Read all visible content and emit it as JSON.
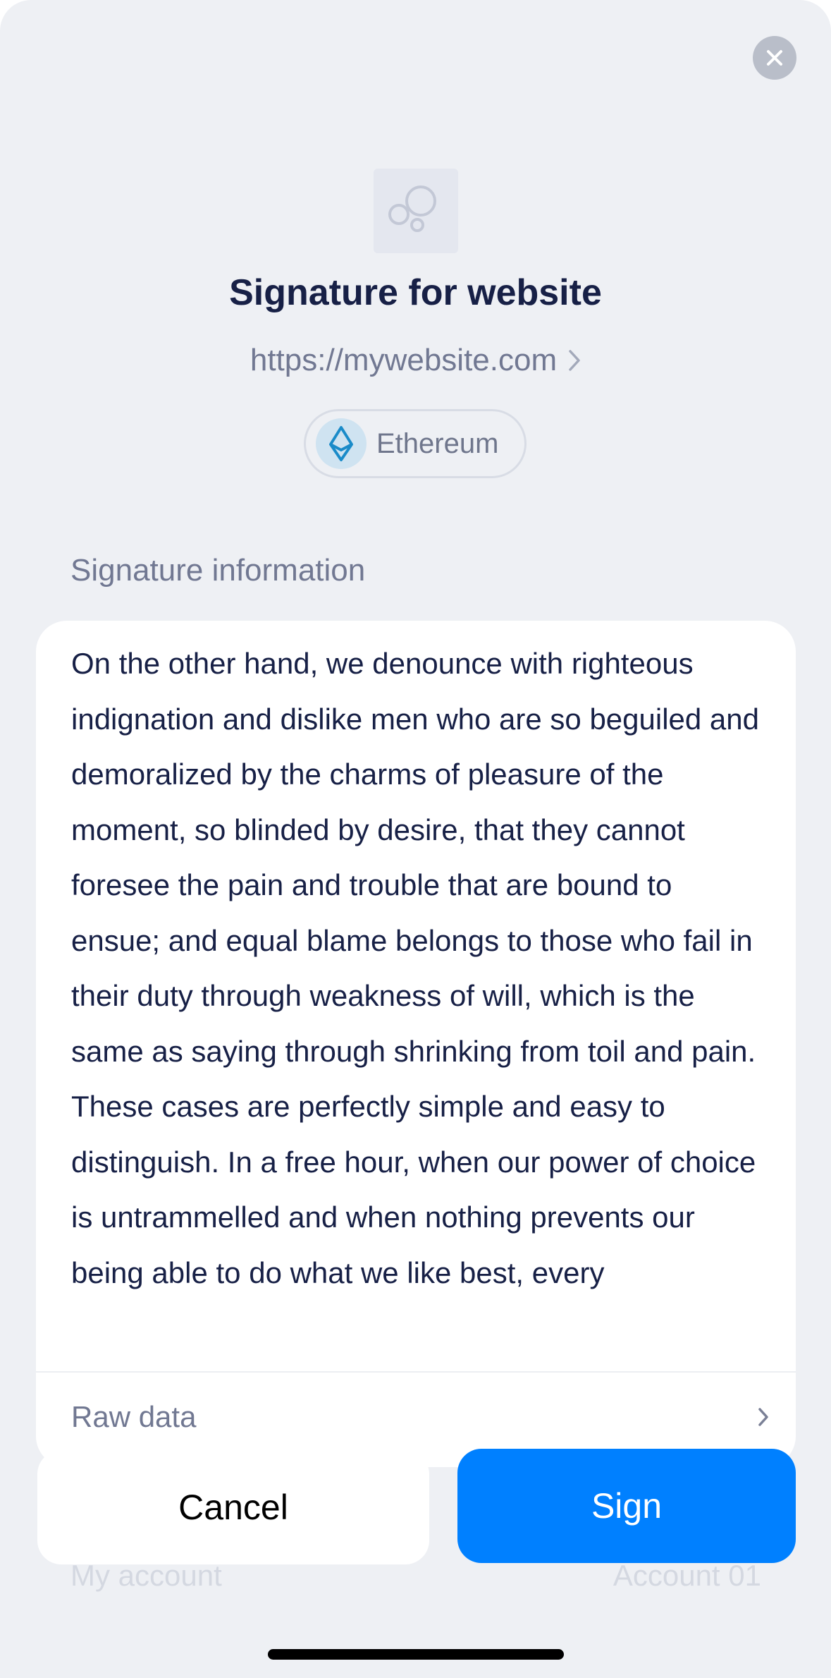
{
  "header": {
    "title": "Signature for website",
    "url": "https://mywebsite.com",
    "close_icon": "close-icon",
    "site_logo_icon": "bubbles-icon",
    "url_chevron_icon": "chevron-right-icon"
  },
  "chain": {
    "name": "Ethereum",
    "icon": "ethereum-icon",
    "color": "#1a8bc9"
  },
  "signature": {
    "section_label": "Signature information",
    "message": "On the other hand, we denounce with righteous indignation and dislike men who are so beguiled and demoralized by the charms of pleasure of the moment, so blinded by desire, that they cannot foresee the pain and trouble that are bound to ensue; and equal blame belongs to those who fail in their duty through weakness of will, which is the same as saying through shrinking from toil and pain. These cases are perfectly simple and easy to distinguish. In a free hour, when our power of choice is untrammelled and when nothing prevents our being able to do what we like best, every",
    "raw_data_label": "Raw data",
    "raw_data_chevron_icon": "chevron-right-icon"
  },
  "account": {
    "label": "My account",
    "value": "Account 01"
  },
  "actions": {
    "cancel_label": "Cancel",
    "sign_label": "Sign"
  },
  "colors": {
    "background": "#eef0f4",
    "accent": "#0080ff",
    "title": "#172046",
    "secondary_text": "#717892"
  }
}
